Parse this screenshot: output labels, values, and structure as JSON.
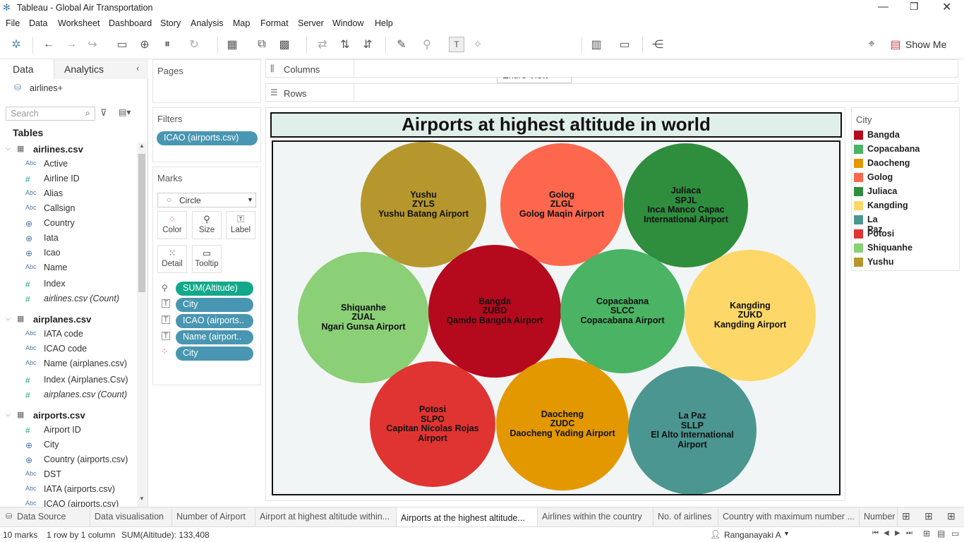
{
  "window": {
    "title": "Tableau - Global Air Transportation"
  },
  "menu": [
    "File",
    "Data",
    "Worksheet",
    "Dashboard",
    "Story",
    "Analysis",
    "Map",
    "Format",
    "Server",
    "Window",
    "Help"
  ],
  "toolbar": {
    "fit": "Entire View",
    "show_me": "Show Me"
  },
  "left": {
    "tab_data": "Data",
    "tab_analytics": "Analytics",
    "datasource": "airlines+",
    "search_placeholder": "Search",
    "tables_label": "Tables",
    "tables": [
      {
        "name": "airlines.csv",
        "fields": [
          {
            "type": "Abc",
            "name": "Active"
          },
          {
            "type": "#",
            "name": "Airline ID"
          },
          {
            "type": "Abc",
            "name": "Alias"
          },
          {
            "type": "Abc",
            "name": "Callsign"
          },
          {
            "type": "geo",
            "name": "Country"
          },
          {
            "type": "geo",
            "name": "Iata"
          },
          {
            "type": "geo",
            "name": "Icao"
          },
          {
            "type": "Abc",
            "name": "Name"
          },
          {
            "type": "#",
            "name": "Index"
          },
          {
            "type": "#",
            "name": "airlines.csv (Count)"
          }
        ]
      },
      {
        "name": "airplanes.csv",
        "fields": [
          {
            "type": "Abc",
            "name": "IATA code"
          },
          {
            "type": "Abc",
            "name": "ICAO code"
          },
          {
            "type": "Abc",
            "name": "Name (airplanes.csv)"
          },
          {
            "type": "#",
            "name": "Index (Airplanes.Csv)"
          },
          {
            "type": "#",
            "name": "airplanes.csv (Count)"
          }
        ]
      },
      {
        "name": "airports.csv",
        "fields": [
          {
            "type": "#",
            "name": "Airport ID"
          },
          {
            "type": "geo",
            "name": "City"
          },
          {
            "type": "geo",
            "name": "Country (airports.csv)"
          },
          {
            "type": "Abc",
            "name": "DST"
          },
          {
            "type": "Abc",
            "name": "IATA (airports.csv)"
          },
          {
            "type": "Abc",
            "name": "ICAO (airports.csv)"
          }
        ]
      }
    ]
  },
  "pages": {
    "title": "Pages"
  },
  "filters": {
    "title": "Filters",
    "items": [
      "ICAO (airports.csv)"
    ]
  },
  "marks": {
    "title": "Marks",
    "type": "Circle",
    "buttons": [
      "Color",
      "Size",
      "Label",
      "Detail",
      "Tooltip"
    ],
    "pills": [
      "SUM(Altitude)",
      "City",
      "ICAO (airports..",
      "Name (airport..",
      "City"
    ]
  },
  "shelves": {
    "columns": "Columns",
    "rows": "Rows"
  },
  "viz": {
    "title": "Airports at highest altitude in world",
    "bubbles": [
      {
        "city": "Yushu",
        "icao": "ZYLS",
        "name": "Yushu Batang Airport",
        "color": "#b5972d"
      },
      {
        "city": "Golog",
        "icao": "ZLGL",
        "name": "Golog Maqin Airport",
        "color": "#fd674e"
      },
      {
        "city": "Juliaca",
        "icao": "SPJL",
        "name": "Inca Manco Capac International Airport",
        "color": "#2f8d3e"
      },
      {
        "city": "Shiquanhe",
        "icao": "ZUAL",
        "name": "Ngari Gunsa Airport",
        "color": "#8bcf77"
      },
      {
        "city": "Bangda",
        "icao": "ZUBD",
        "name": "Qamdo Bangda Airport",
        "color": "#b5091e"
      },
      {
        "city": "Copacabana",
        "icao": "SLCC",
        "name": "Copacabana Airport",
        "color": "#4ab364"
      },
      {
        "city": "Kangding",
        "icao": "ZUKD",
        "name": "Kangding Airport",
        "color": "#fdd767"
      },
      {
        "city": "Potosi",
        "icao": "SLPO",
        "name": "Capitan Nicolas Rojas Airport",
        "color": "#e03432"
      },
      {
        "city": "Daocheng",
        "icao": "ZUDC",
        "name": "Daocheng Yading Airport",
        "color": "#e39800"
      },
      {
        "city": "La Paz",
        "icao": "SLLP",
        "name": "El Alto International Airport",
        "color": "#4b9690"
      }
    ]
  },
  "legend": {
    "title": "City",
    "items": [
      {
        "label": "Bangda",
        "color": "#b5091e"
      },
      {
        "label": "Copacabana",
        "color": "#4ab364"
      },
      {
        "label": "Daocheng",
        "color": "#e39800"
      },
      {
        "label": "Golog",
        "color": "#fd674e"
      },
      {
        "label": "Juliaca",
        "color": "#2f8d3e"
      },
      {
        "label": "Kangding",
        "color": "#fdd767"
      },
      {
        "label": "La Paz",
        "color": "#4b9690"
      },
      {
        "label": "Potosi",
        "color": "#e03432"
      },
      {
        "label": "Shiquanhe",
        "color": "#8bcf77"
      },
      {
        "label": "Yushu",
        "color": "#b5972d"
      }
    ]
  },
  "sheet_tabs": [
    "Data Source",
    "Data visualisation",
    "Number of Airport",
    "Airport at highest altitude within...",
    "Airports at the highest altitude...",
    "Airlines within the country",
    "No. of airlines",
    "Country with maximum number ...",
    "Number"
  ],
  "active_tab": 4,
  "status": {
    "marks": "10 marks",
    "rows": "1 row by 1 column",
    "sum": "SUM(Altitude): 133,408",
    "user": "Ranganayaki A"
  }
}
